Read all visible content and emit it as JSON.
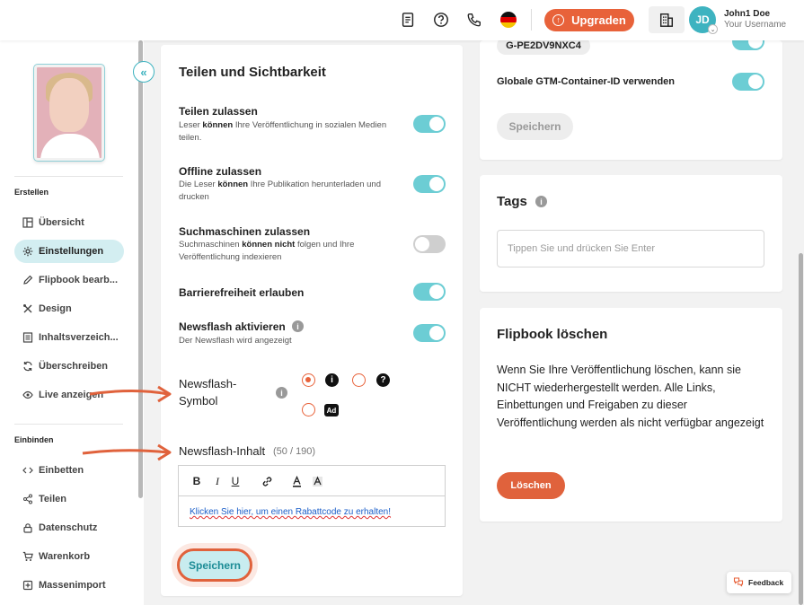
{
  "header": {
    "upgrade_label": "Upgraden",
    "user_name": "John1 Doe",
    "user_handle": "Your Username",
    "avatar_initials": "JD",
    "icons": [
      "document-icon",
      "help-icon",
      "phone-icon",
      "flag-de-icon",
      "building-icon"
    ]
  },
  "sidebar": {
    "section_create": "Erstellen",
    "section_embed": "Einbinden",
    "items_create": [
      {
        "label": "Übersicht",
        "icon": "layout-icon"
      },
      {
        "label": "Einstellungen",
        "icon": "gear-icon",
        "active": true
      },
      {
        "label": "Flipbook bearb...",
        "icon": "pencil-icon"
      },
      {
        "label": "Design",
        "icon": "tools-icon"
      },
      {
        "label": "Inhaltsverzeich...",
        "icon": "list-icon"
      },
      {
        "label": "Überschreiben",
        "icon": "refresh-icon"
      },
      {
        "label": "Live anzeigen",
        "icon": "eye-icon"
      }
    ],
    "items_embed": [
      {
        "label": "Einbetten",
        "icon": "code-icon"
      },
      {
        "label": "Teilen",
        "icon": "share-icon"
      },
      {
        "label": "Datenschutz",
        "icon": "lock-icon"
      },
      {
        "label": "Warenkorb",
        "icon": "cart-icon"
      },
      {
        "label": "Massenimport",
        "icon": "import-icon"
      }
    ]
  },
  "share": {
    "title": "Teilen und Sichtbarkeit",
    "rows": [
      {
        "title": "Teilen zulassen",
        "desc_pre": "Leser ",
        "desc_bold": "können",
        "desc_post": " Ihre Veröffentlichung in sozialen Medien teilen.",
        "on": true
      },
      {
        "title": "Offline zulassen",
        "desc_pre": "Die Leser ",
        "desc_bold": "können",
        "desc_post": " Ihre Publikation herunterladen und drucken",
        "on": true
      },
      {
        "title": "Suchmaschinen zulassen",
        "desc_pre": "Suchmaschinen ",
        "desc_bold": "können nicht",
        "desc_post": " folgen und Ihre Veröffentlichung indexieren",
        "on": false
      },
      {
        "title": "Barrierefreiheit erlauben",
        "on": true
      },
      {
        "title": "Newsflash aktivieren",
        "desc": "Der Newsflash wird angezeigt",
        "on": true
      }
    ],
    "symbol_label": "Newsflash-Symbol",
    "symbol_label_1": "Newsflash-",
    "symbol_label_2": "Symbol",
    "symbols": [
      "i",
      "?",
      "Ad"
    ],
    "content_label": "Newsflash-Inhalt",
    "content_count": "(50 / 190)",
    "toolbar": [
      "B",
      "I",
      "U"
    ],
    "editor_text": "Klicken Sie hier, um einen Rabattcode zu erhalten!",
    "save_label": "Speichern"
  },
  "gtm": {
    "container_id": "G-PE2DV9NXC4",
    "global_label": "Globale GTM-Container-ID verwenden",
    "save_label": "Speichern"
  },
  "tags": {
    "title": "Tags",
    "placeholder": "Tippen Sie und drücken Sie Enter"
  },
  "delete": {
    "title": "Flipbook löschen",
    "text": "Wenn Sie Ihre Veröffentlichung löschen, kann sie NICHT wiederhergestellt werden. Alle Links, Einbettungen und Freigaben zu dieser Veröffentlichung werden als nicht verfügbar angezeigt",
    "button": "Löschen"
  },
  "feedback_label": "Feedback",
  "colors": {
    "accent": "#3eb3c0",
    "toggle_on": "#6ccdd4",
    "brand_orange": "#e8623a"
  }
}
